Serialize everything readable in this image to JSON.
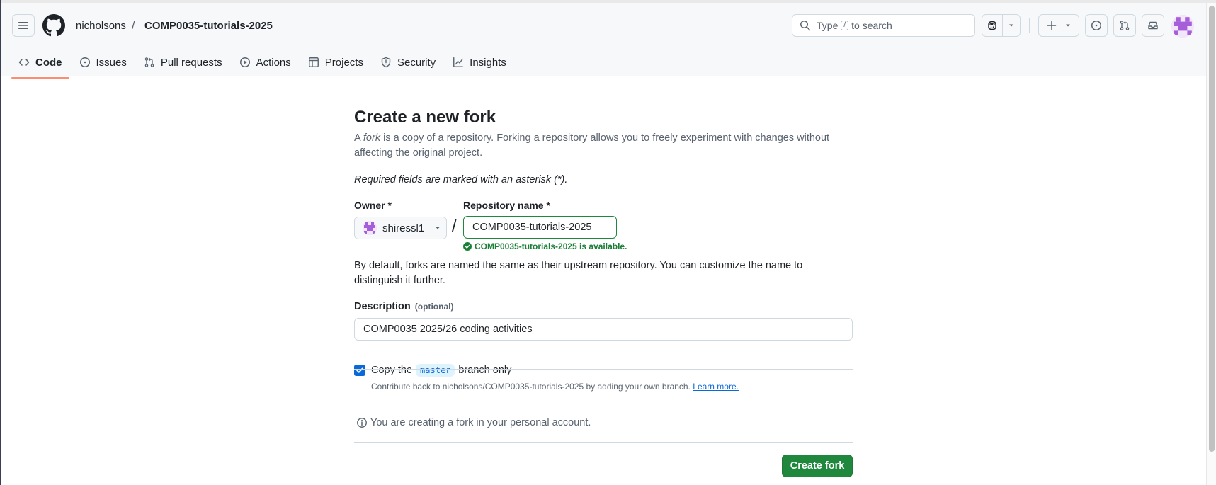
{
  "header": {
    "owner": "nicholsons",
    "separator": "/",
    "repo": "COMP0035-tutorials-2025",
    "search_prefix": "Type",
    "search_key": "/",
    "search_suffix": "to search"
  },
  "repo_nav": {
    "items": [
      {
        "label": "Code",
        "icon": "code-icon",
        "active": true
      },
      {
        "label": "Issues",
        "icon": "issue-icon"
      },
      {
        "label": "Pull requests",
        "icon": "pull-request-icon"
      },
      {
        "label": "Actions",
        "icon": "play-icon"
      },
      {
        "label": "Projects",
        "icon": "table-icon"
      },
      {
        "label": "Security",
        "icon": "shield-icon"
      },
      {
        "label": "Insights",
        "icon": "graph-icon"
      }
    ]
  },
  "form": {
    "title": "Create a new fork",
    "intro_a": "A ",
    "intro_fork": "fork",
    "intro_rest": " is a copy of a repository. Forking a repository allows you to freely experiment with changes without affecting the original project.",
    "required_note": "Required fields are marked with an asterisk (*).",
    "owner_label": "Owner *",
    "owner_value": "shiressl1",
    "slash": "/",
    "repo_label": "Repository name *",
    "repo_value": "COMP0035-tutorials-2025",
    "availability": "COMP0035-tutorials-2025 is available.",
    "default_note": "By default, forks are named the same as their upstream repository. You can customize the name to distinguish it further.",
    "description_label": "Description",
    "description_optional": "(optional)",
    "description_value": "COMP0035 2025/26 coding activities",
    "copy_prefix": "Copy the",
    "copy_branch": "master",
    "copy_suffix": "branch only",
    "copy_checked": true,
    "copy_sub": "Contribute back to nicholsons/COMP0035-tutorials-2025 by adding your own branch.",
    "learn_more": "Learn more.",
    "info_text": "You are creating a fork in your personal account.",
    "create_button": "Create fork"
  },
  "colors": {
    "accent": "#0969da",
    "success": "#1a7f37",
    "button_green": "#1f883d",
    "nav_underline": "#fd8c73"
  }
}
